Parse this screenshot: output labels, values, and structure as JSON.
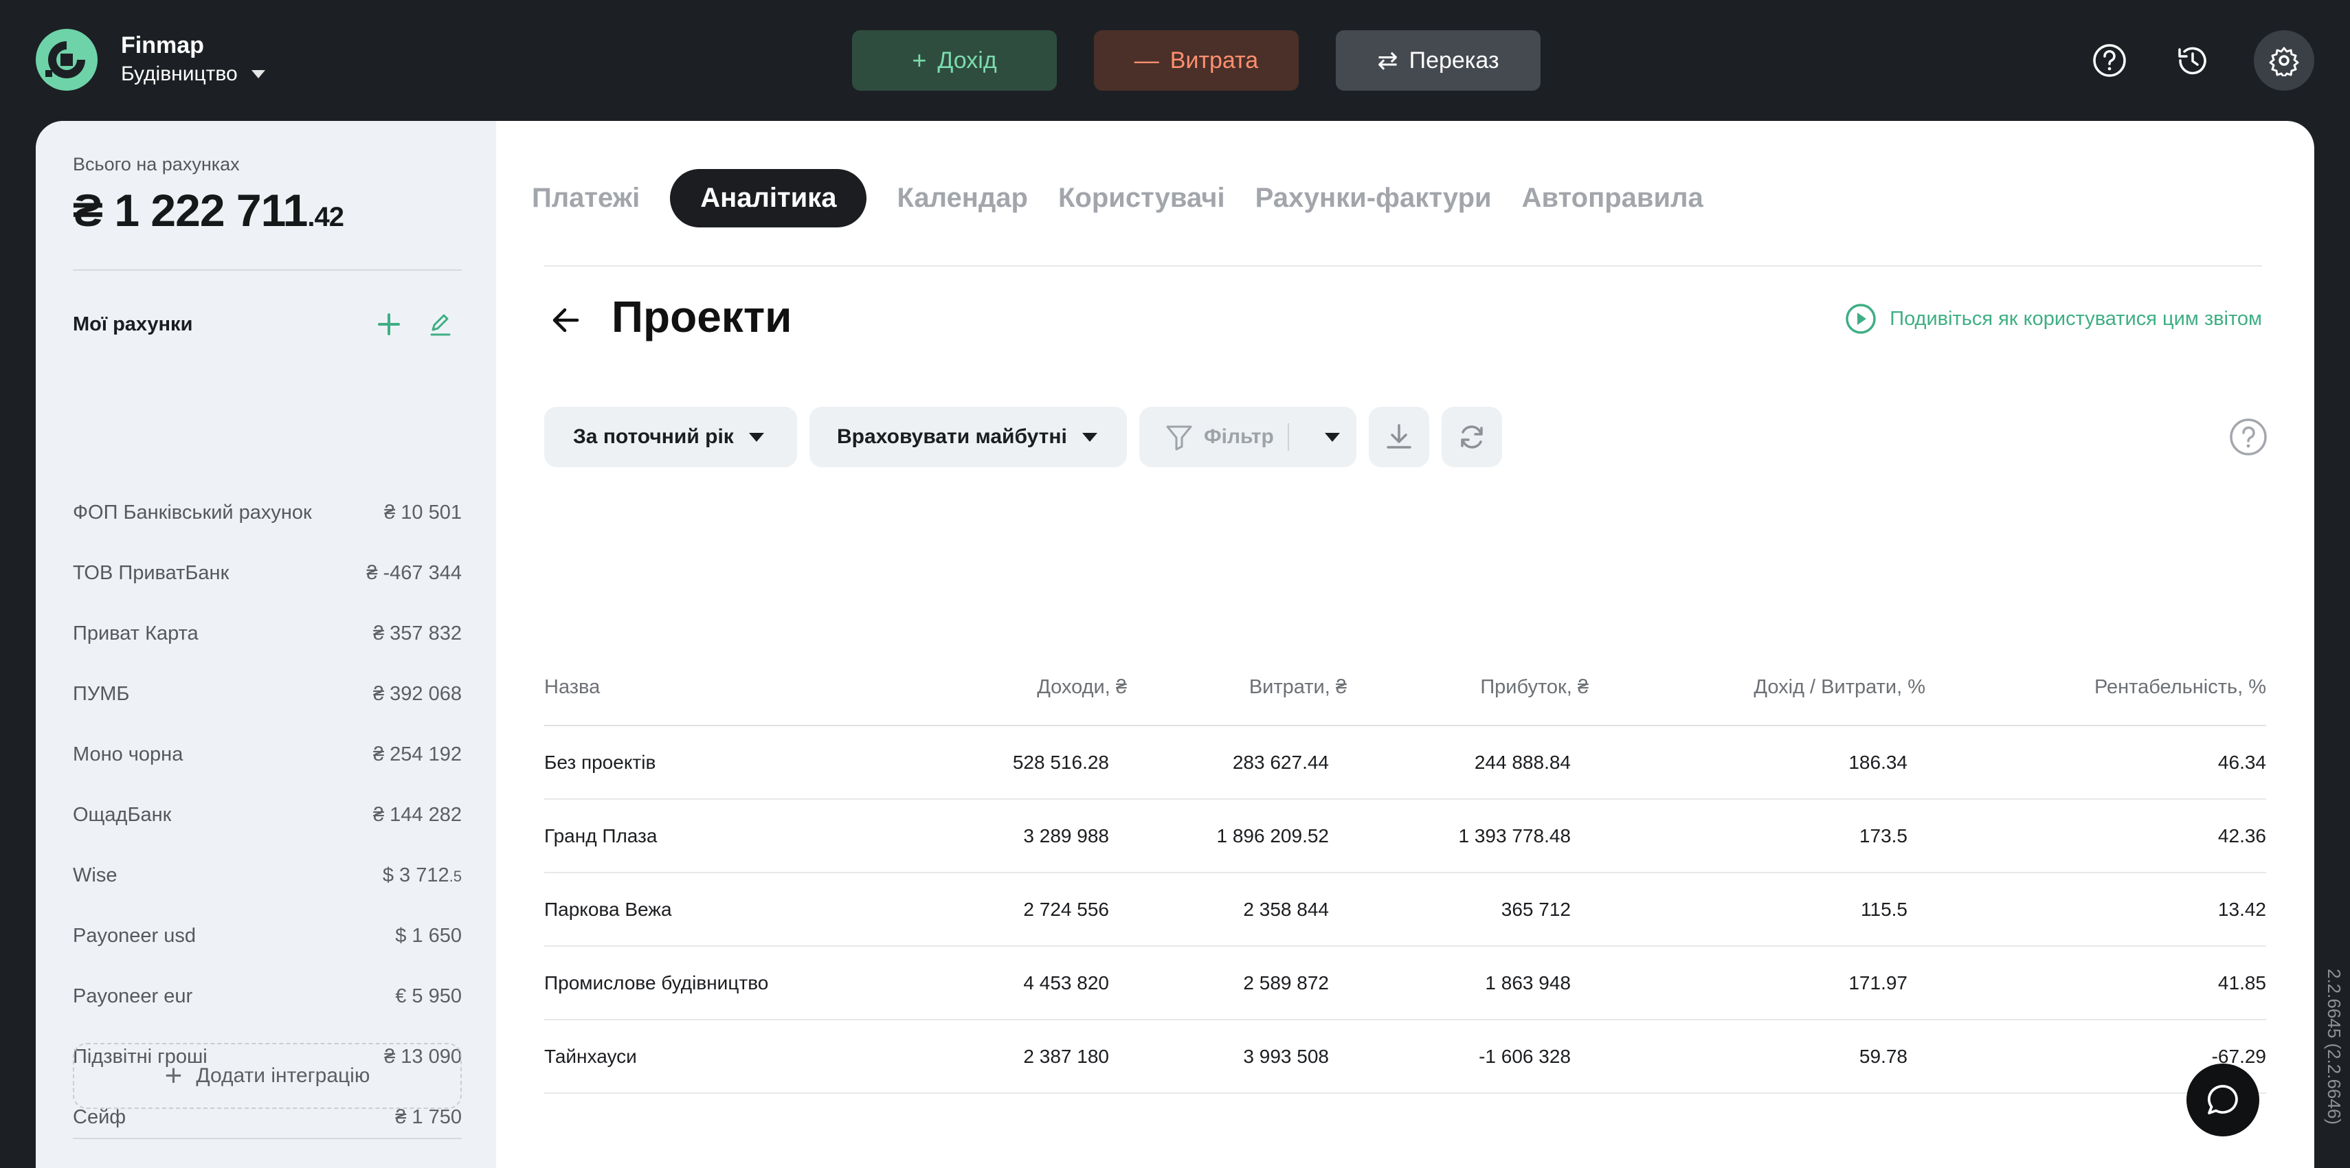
{
  "brand": {
    "name": "Finmap",
    "company": "Будівництво",
    "logo_color": "#6fd3a9"
  },
  "actions": {
    "income": {
      "icon": "plus-icon",
      "label": "Дохід",
      "color": "#7bdcad"
    },
    "expense": {
      "icon": "minus-icon",
      "label": "Витрата",
      "color": "#ff8f6f"
    },
    "transfer": {
      "icon": "transfer-icon",
      "label": "Переказ",
      "color": "#ffffff"
    }
  },
  "top_icons": [
    "help-icon",
    "history-icon",
    "settings-icon"
  ],
  "sidebar": {
    "total_label": "Всього на рахунках",
    "total_main": "₴ 1 222 711",
    "total_cents": ".42",
    "accounts_title": "Мої рахунки",
    "accounts": [
      {
        "name": "ФОП Банківський рахунок",
        "amount": "₴ 10 501"
      },
      {
        "name": "ТОВ ПриватБанк",
        "amount": "₴ -467 344"
      },
      {
        "name": "Приват Карта",
        "amount": "₴ 357 832"
      },
      {
        "name": "ПУМБ",
        "amount": "₴ 392 068"
      },
      {
        "name": "Моно чорна",
        "amount": "₴ 254 192"
      },
      {
        "name": "ОщадБанк",
        "amount": "₴ 144 282"
      },
      {
        "name": "Wise",
        "amount": "$ 3 712",
        "amount_small": ".5"
      },
      {
        "name": "Payoneer usd",
        "amount": "$ 1 650"
      },
      {
        "name": "Payoneer eur",
        "amount": "€ 5 950"
      },
      {
        "name": "Підзвітні гроші",
        "amount": "₴ 13 090"
      },
      {
        "name": "Сейф",
        "amount": "₴ 1 750"
      }
    ],
    "add_integration": "Додати інтеграцію"
  },
  "tabs": [
    {
      "label": "Платежі",
      "active": false
    },
    {
      "label": "Аналітика",
      "active": true
    },
    {
      "label": "Календар",
      "active": false
    },
    {
      "label": "Користувачі",
      "active": false
    },
    {
      "label": "Рахунки-фактури",
      "active": false
    },
    {
      "label": "Автоправила",
      "active": false
    }
  ],
  "page": {
    "title": "Проекти",
    "howto_link": "Подивіться як користуватися цим звітом",
    "accent": "#3fae84"
  },
  "controls": {
    "period": "За поточний рік",
    "future": "Враховувати майбутні",
    "filter": "Фільтр"
  },
  "table": {
    "columns": [
      "Назва",
      "Доходи, ₴",
      "Витрати, ₴",
      "Прибуток, ₴",
      "Дохід / Витрати, %",
      "Рентабельність, %"
    ],
    "rows": [
      [
        "Без проектів",
        "528 516.28",
        "283 627.44",
        "244 888.84",
        "186.34",
        "46.34"
      ],
      [
        "Гранд Плаза",
        "3 289 988",
        "1 896 209.52",
        "1 393 778.48",
        "173.5",
        "42.36"
      ],
      [
        "Паркова Вежа",
        "2 724 556",
        "2 358 844",
        "365 712",
        "115.5",
        "13.42"
      ],
      [
        "Промислове будівництво",
        "4 453 820",
        "2 589 872",
        "1 863 948",
        "171.97",
        "41.85"
      ],
      [
        "Тайнхауси",
        "2 387 180",
        "3 993 508",
        "-1 606 328",
        "59.78",
        "-67.29"
      ]
    ]
  },
  "version": "2.2.6645 (2.2.6646)"
}
